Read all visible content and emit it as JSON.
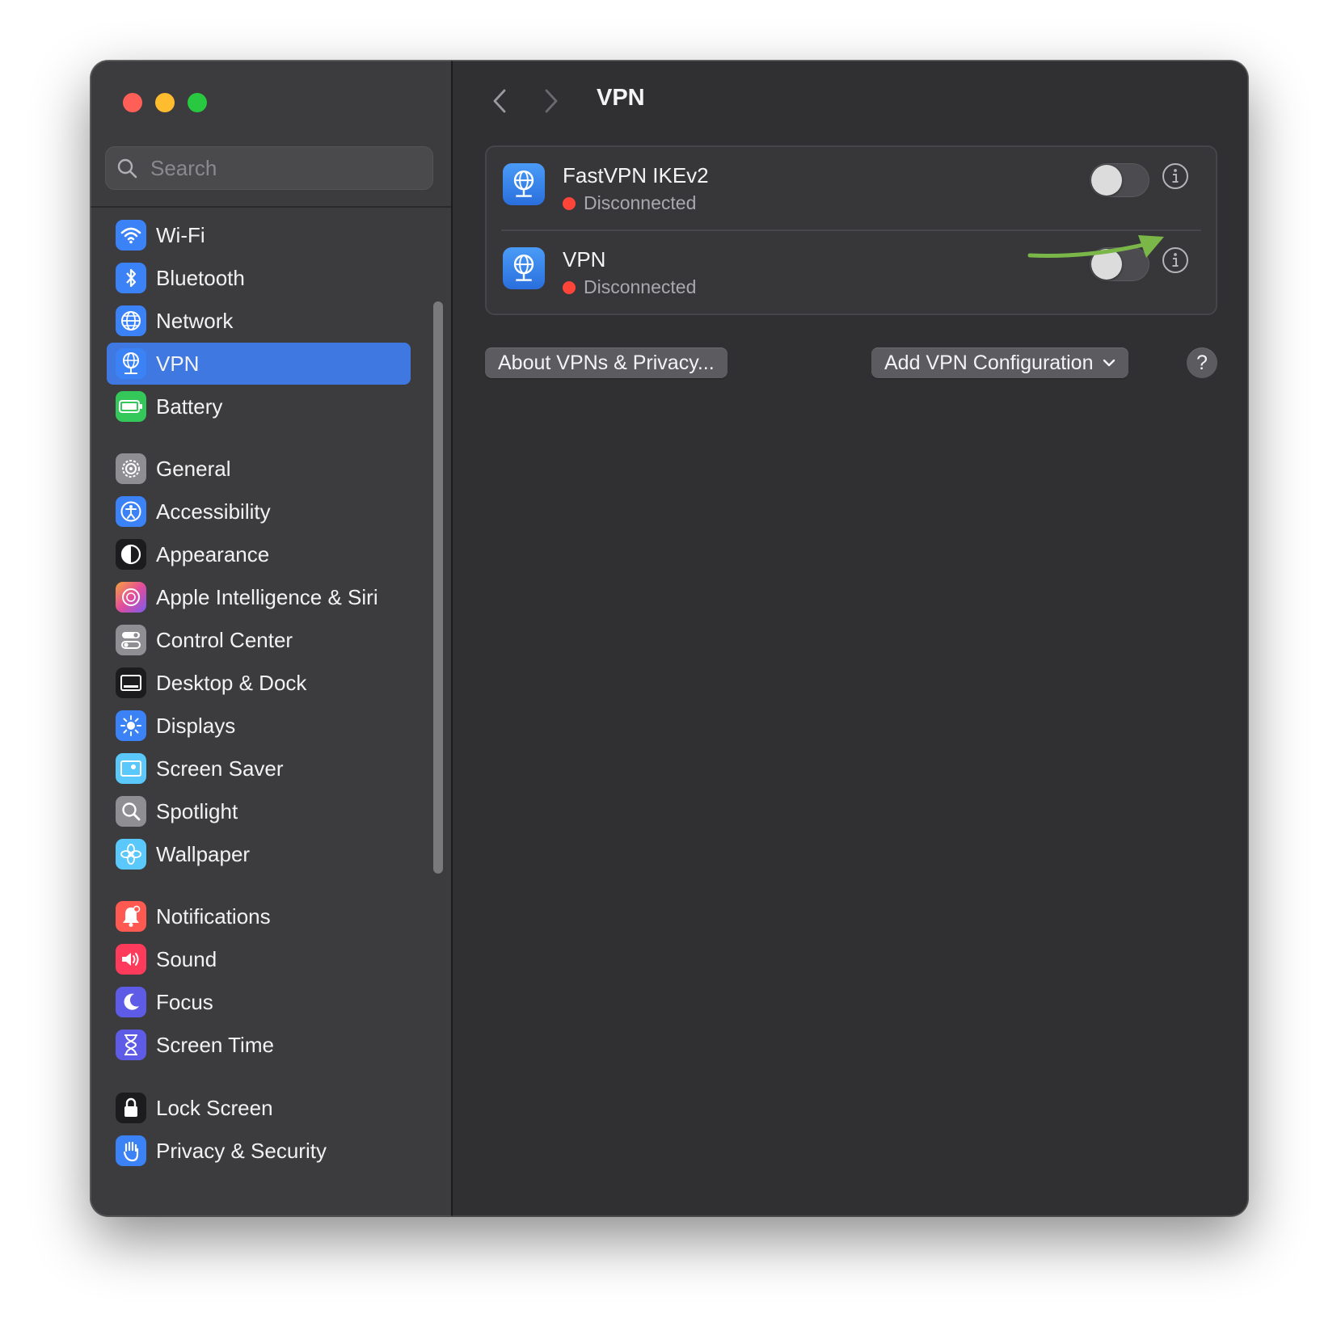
{
  "window": {
    "traffic_lights": [
      "close",
      "minimize",
      "zoom"
    ]
  },
  "sidebar": {
    "search": {
      "placeholder": "Search",
      "value": ""
    },
    "items": [
      {
        "label": "Wi-Fi",
        "icon": "wifi-icon",
        "color": "#3b82f6"
      },
      {
        "label": "Bluetooth",
        "icon": "bluetooth-icon",
        "color": "#3b82f6"
      },
      {
        "label": "Network",
        "icon": "globe-icon",
        "color": "#3b82f6"
      },
      {
        "label": "VPN",
        "icon": "vpn-globe-icon",
        "color": "#3b82f6",
        "selected": true
      },
      {
        "label": "Battery",
        "icon": "battery-icon",
        "color": "#34c759"
      },
      {
        "label": "General",
        "icon": "gear-icon",
        "color": "#8e8e93"
      },
      {
        "label": "Accessibility",
        "icon": "accessibility-icon",
        "color": "#3b82f6"
      },
      {
        "label": "Appearance",
        "icon": "appearance-icon",
        "color": "#1c1c1e"
      },
      {
        "label": "Apple Intelligence & Siri",
        "icon": "siri-icon",
        "color": "#d65fd1"
      },
      {
        "label": "Control Center",
        "icon": "control-center-icon",
        "color": "#8e8e93"
      },
      {
        "label": "Desktop & Dock",
        "icon": "dock-icon",
        "color": "#1c1c1e"
      },
      {
        "label": "Displays",
        "icon": "sun-icon",
        "color": "#3b82f6"
      },
      {
        "label": "Screen Saver",
        "icon": "screen-saver-icon",
        "color": "#5ac8fa"
      },
      {
        "label": "Spotlight",
        "icon": "magnifier-icon",
        "color": "#8e8e93"
      },
      {
        "label": "Wallpaper",
        "icon": "flower-icon",
        "color": "#5ac8fa"
      },
      {
        "label": "Notifications",
        "icon": "bell-icon",
        "color": "#ff5a52"
      },
      {
        "label": "Sound",
        "icon": "speaker-icon",
        "color": "#ff3b5c"
      },
      {
        "label": "Focus",
        "icon": "moon-icon",
        "color": "#5e5ce6"
      },
      {
        "label": "Screen Time",
        "icon": "hourglass-icon",
        "color": "#5e5ce6"
      },
      {
        "label": "Lock Screen",
        "icon": "lock-icon",
        "color": "#1c1c1e"
      },
      {
        "label": "Privacy & Security",
        "icon": "hand-icon",
        "color": "#3b82f6"
      }
    ]
  },
  "main": {
    "title": "VPN",
    "vpn_list": [
      {
        "name": "FastVPN IKEv2",
        "status": "Disconnected",
        "enabled": false
      },
      {
        "name": "VPN",
        "status": "Disconnected",
        "enabled": false
      }
    ],
    "about_button": "About VPNs & Privacy...",
    "add_button": "Add VPN Configuration",
    "help_button": "?"
  },
  "colors": {
    "accent": "#3f78e0",
    "status_disconnected": "#ff453a",
    "annotation_arrow": "#7ab648"
  }
}
